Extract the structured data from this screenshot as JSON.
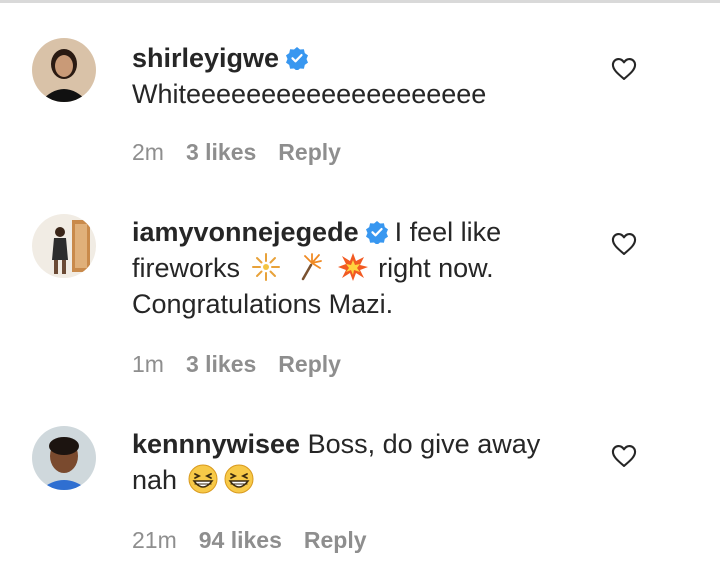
{
  "comments": [
    {
      "username": "shirleyigwe",
      "verified": true,
      "text": "Whiteeeeeeeeeeeeeeeeeeee",
      "time": "2m",
      "likes": "3 likes",
      "reply": "Reply"
    },
    {
      "username": "iamyvonnejegede",
      "verified": true,
      "text_part1": "I feel like",
      "text_part2": "fireworks",
      "emojis": [
        "fireworks-emoji",
        "sparkler-emoji",
        "collision-emoji"
      ],
      "text_part3": "right now.",
      "text_part4": "Congratulations Mazi.",
      "time": "1m",
      "likes": "3 likes",
      "reply": "Reply"
    },
    {
      "username": "kennnywisee",
      "verified": false,
      "text_part1": "Boss, do give away",
      "text_part2": "nah",
      "emojis": [
        "grinning-squinting-face-emoji",
        "grinning-squinting-face-emoji"
      ],
      "time": "21m",
      "likes": "94 likes",
      "reply": "Reply"
    }
  ],
  "colors": {
    "verified_badge": "#3897f0",
    "meta_text": "#8e8e8e",
    "body_text": "#262626"
  }
}
